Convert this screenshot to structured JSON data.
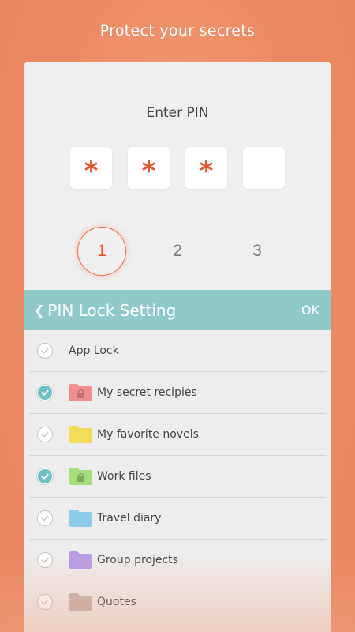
{
  "headline": "Protect your secrets",
  "pin": {
    "title": "Enter PIN",
    "digits": [
      "*",
      "*",
      "*",
      ""
    ]
  },
  "keypad": {
    "keys": [
      "1",
      "2",
      "3"
    ],
    "active_key": "1"
  },
  "panel": {
    "title": "PIN Lock Setting",
    "ok_label": "OK",
    "app_lock": {
      "label": "App Lock",
      "checked": false
    },
    "items": [
      {
        "label": "My secret recipies",
        "checked": true,
        "folder_color": "#f08f8f",
        "locked": true,
        "folder_icon": "folder-lock-icon"
      },
      {
        "label": "My favorite novels",
        "checked": false,
        "folder_color": "#f3dc5a",
        "locked": false,
        "folder_icon": "folder-icon"
      },
      {
        "label": "Work files",
        "checked": true,
        "folder_color": "#a6dd7c",
        "locked": true,
        "folder_icon": "folder-lock-icon"
      },
      {
        "label": "Travel diary",
        "checked": false,
        "folder_color": "#8ccbe9",
        "locked": false,
        "folder_icon": "folder-icon"
      },
      {
        "label": "Group projects",
        "checked": false,
        "folder_color": "#b79be6",
        "locked": false,
        "folder_icon": "folder-icon"
      },
      {
        "label": "Quotes",
        "checked": false,
        "folder_color": "#c4b3ae",
        "locked": false,
        "folder_icon": "folder-icon"
      }
    ]
  },
  "colors": {
    "accent": "#e8552a",
    "header": "#8fcac8",
    "check_on": "#6dc0c4"
  }
}
